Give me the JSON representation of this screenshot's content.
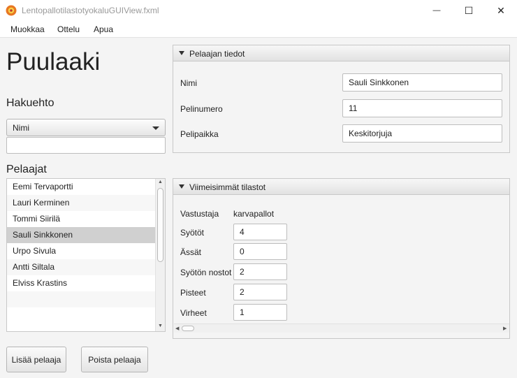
{
  "window": {
    "title": "LentopallotilastotyokaluGUIView.fxml",
    "minimize_glyph": "—",
    "maximize_glyph": "☐",
    "close_glyph": "✕"
  },
  "menu": [
    "Muokkaa",
    "Ottelu",
    "Apua"
  ],
  "team": {
    "name": "Puulaaki"
  },
  "search": {
    "label": "Hakuehto",
    "criterion": "Nimi",
    "value": ""
  },
  "players": {
    "label": "Pelaajat",
    "items": [
      "Eemi Tervaportti",
      "Lauri Kerminen",
      "Tommi Siirilä",
      "Sauli Sinkkonen",
      "Urpo Sivula",
      "Antti Siltala",
      "Elviss Krastins"
    ],
    "selected": "Sauli Sinkkonen"
  },
  "buttons": {
    "add": "Lisää pelaaja",
    "remove": "Poista pelaaja"
  },
  "player_info": {
    "title": "Pelaajan tiedot",
    "name_label": "Nimi",
    "name_value": "Sauli Sinkkonen",
    "number_label": "Pelinumero",
    "number_value": "11",
    "position_label": "Pelipaikka",
    "position_value": "Keskitorjuja"
  },
  "latest_stats": {
    "title": "Viimeisimmät tilastot",
    "opponent_label": "Vastustaja",
    "opponent_value": "karvapallot",
    "rows": [
      {
        "label": "Syötöt",
        "value": "4"
      },
      {
        "label": "Ässät",
        "value": "0"
      },
      {
        "label": "Syötön nostot",
        "value": "2"
      },
      {
        "label": "Pisteet",
        "value": "2"
      },
      {
        "label": "Virheet",
        "value": "1"
      }
    ]
  },
  "icons": {
    "app": "app-logo-icon",
    "combo": "chevron-down-icon",
    "pane": "triangle-down-icon"
  },
  "colors": {
    "selection": "#d0d0d0",
    "app_icon": "#e87722"
  }
}
